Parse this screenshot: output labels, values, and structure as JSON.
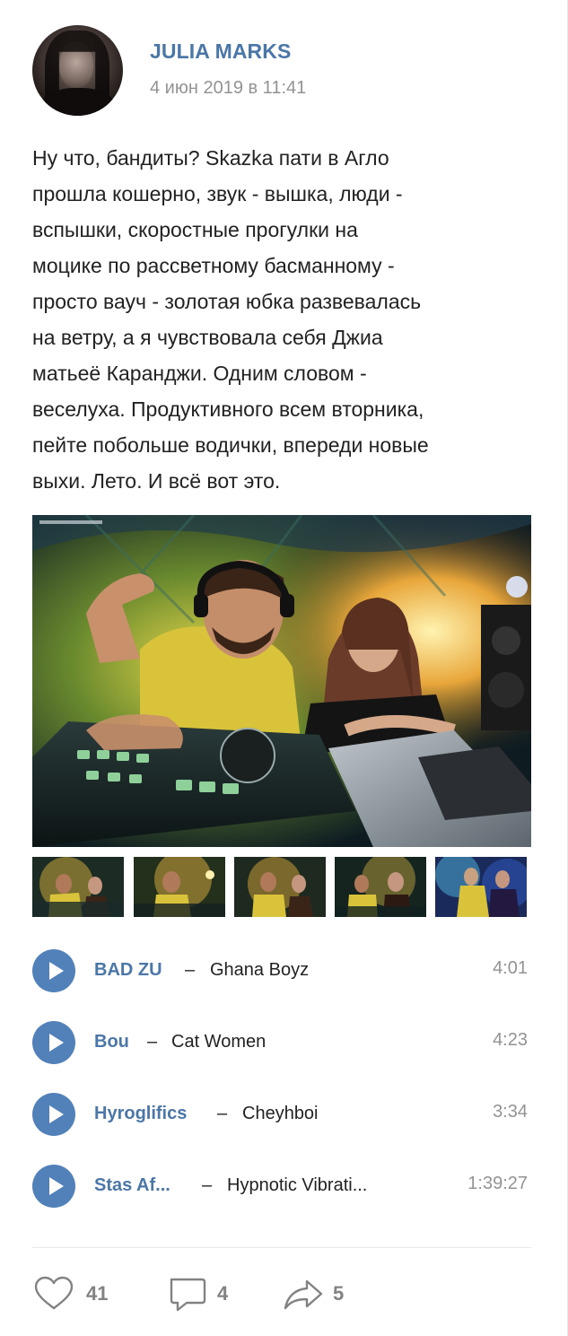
{
  "post": {
    "author": "JULIA MARKS",
    "date": "4 июн 2019 в 11:41",
    "text": "Ну что, бандиты? Skazka пати в Агло\nпрошла кошерно, звук - вышка, люди -\nвспышки, скоростные прогулки на\nмоцике по рассветному басманному -\nпросто вауч - золотая юбка развевалась\nна ветру, а я чувствовала себя Джиа\nматьеё Каранджи. Одним словом -\nвеселуха. Продуктивного всем вторника,\nпейте побольше водички, впереди новые\nвыхи. Лето. И всё вот это."
  },
  "photos": {
    "main_icon": "dj-party-photo",
    "thumbnails": [
      "dj-photo-thumb-1",
      "dj-photo-thumb-2",
      "dj-photo-thumb-3",
      "dj-photo-thumb-4",
      "dj-photo-thumb-5"
    ]
  },
  "audio": [
    {
      "artist": "BAD ZU",
      "title": "Ghana Boyz",
      "duration": "4:01"
    },
    {
      "artist": "Bou",
      "title": "Cat Women",
      "duration": "4:23"
    },
    {
      "artist": "Hyroglifics",
      "title": "Cheyhboi",
      "duration": "3:34"
    },
    {
      "artist": "Stas Af...",
      "title": "Hypnotic Vibrati...",
      "duration": "1:39:27"
    }
  ],
  "actions": {
    "likes": "41",
    "comments": "4",
    "shares": "5"
  },
  "colors": {
    "link": "#4a76a8",
    "play_button": "#5181b8",
    "muted": "#939393",
    "action_icon": "#828282"
  }
}
